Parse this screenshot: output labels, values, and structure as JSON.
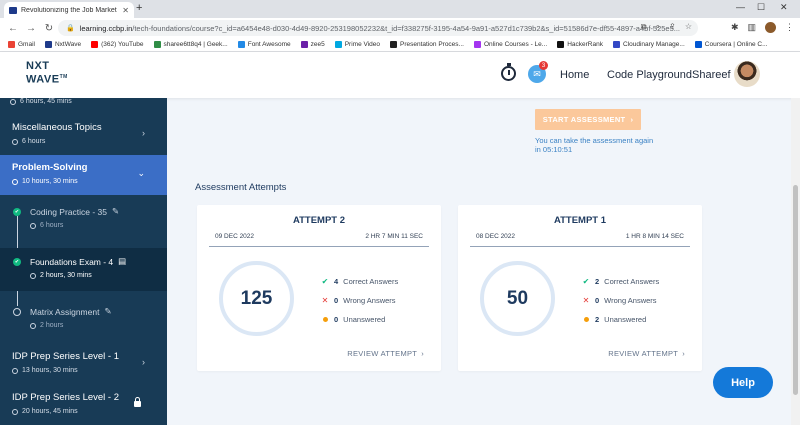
{
  "browser": {
    "tab_title": "Revolutionizing the Job Market",
    "url_host": "learning.ccbp.in",
    "url_path": "/tech-foundations/course?c_id=a6454e48-d030-4d49-8920-253198052232&t_id=f338275f-3195-4a54-9a91-a527d1c739b2&s_id=51586d7e-df55-4897-a4bf-525e5...",
    "bookmarks": [
      {
        "label": "Gmail",
        "color": "#ea4335"
      },
      {
        "label": "NxtWave",
        "color": "#1e3a8a"
      },
      {
        "label": "(362) YouTube",
        "color": "#ff0000"
      },
      {
        "label": "sharee6tt8q4 | Geek...",
        "color": "#2f8d46"
      },
      {
        "label": "Font Awesome",
        "color": "#228ae6"
      },
      {
        "label": "zee5",
        "color": "#6b21a8"
      },
      {
        "label": "Prime Video",
        "color": "#00a8e1"
      },
      {
        "label": "Presentation Proces...",
        "color": "#222222"
      },
      {
        "label": "Online Courses - Le...",
        "color": "#a435f0"
      },
      {
        "label": "HackerRank",
        "color": "#111111"
      },
      {
        "label": "Cloudinary Manage...",
        "color": "#3448c5"
      },
      {
        "label": "Coursera | Online C...",
        "color": "#0056d2"
      }
    ]
  },
  "header": {
    "logo_line1": "NXT",
    "logo_line2": "WAVE",
    "logo_tm": "TM",
    "notification_count": "3",
    "nav_home": "Home",
    "nav_playground": "Code Playground",
    "user_name": "Shareef"
  },
  "sidebar": {
    "top_duration": "6 hours, 45 mins",
    "sections": [
      {
        "title": "Miscellaneous Topics",
        "duration": "6 hours"
      },
      {
        "title": "Problem-Solving",
        "duration": "10 hours, 30 mins"
      },
      {
        "title": "IDP Prep Series Level - 1",
        "duration": "13 hours, 30 mins"
      },
      {
        "title": "IDP Prep Series Level - 2",
        "duration": "20 hours, 45 mins"
      }
    ],
    "items": [
      {
        "title": "Coding Practice - 35",
        "duration": "6 hours"
      },
      {
        "title": "Foundations Exam - 4",
        "duration": "2 hours, 30 mins"
      },
      {
        "title": "Matrix Assignment",
        "duration": "2 hours"
      }
    ]
  },
  "main": {
    "start_button": "START ASSESSMENT",
    "retake_note": "You can take the assessment again in 05:10:51",
    "attempts_heading": "Assessment Attempts",
    "attempts": [
      {
        "title": "ATTEMPT 2",
        "date": "09 DEC 2022",
        "duration": "2 HR 7 MIN 11 SEC",
        "score": "125",
        "correct": "4",
        "wrong": "0",
        "unanswered": "0"
      },
      {
        "title": "ATTEMPT 1",
        "date": "08 DEC 2022",
        "duration": "1 HR 8 MIN 14 SEC",
        "score": "50",
        "correct": "2",
        "wrong": "0",
        "unanswered": "2"
      }
    ],
    "label_correct": "Correct Answers",
    "label_wrong": "Wrong Answers",
    "label_unanswered": "Unanswered",
    "review_label": "REVIEW ATTEMPT"
  },
  "help_label": "Help"
}
